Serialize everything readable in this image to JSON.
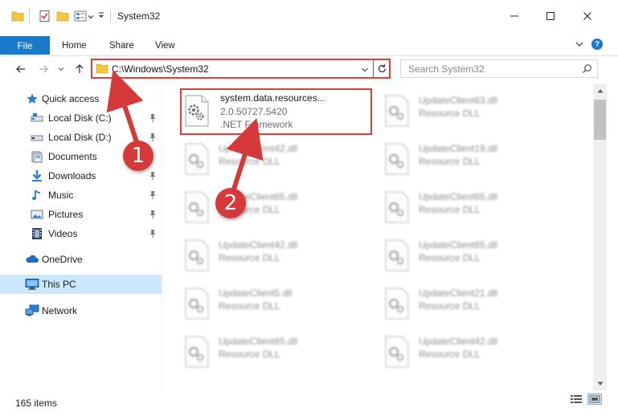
{
  "window": {
    "title": "System32",
    "min_label": "─",
    "max_label": "☐",
    "close_label": "✕"
  },
  "ribbon": {
    "tabs": [
      {
        "label": "File"
      },
      {
        "label": "Home"
      },
      {
        "label": "Share"
      },
      {
        "label": "View"
      }
    ],
    "help": "?"
  },
  "address_bar": {
    "path": "C:\\Windows\\System32"
  },
  "search": {
    "placeholder": "Search System32"
  },
  "sidebar": {
    "items": [
      {
        "label": "Quick access",
        "icon": "star-icon"
      },
      {
        "label": "Local Disk (C:)",
        "icon": "drive-icon"
      },
      {
        "label": "Local Disk (D:)",
        "icon": "drive-icon"
      },
      {
        "label": "Documents",
        "icon": "documents-icon"
      },
      {
        "label": "Downloads",
        "icon": "download-icon"
      },
      {
        "label": "Music",
        "icon": "music-icon"
      },
      {
        "label": "Pictures",
        "icon": "pictures-icon"
      },
      {
        "label": "Videos",
        "icon": "videos-icon"
      },
      {
        "label": "OneDrive",
        "icon": "cloud-icon"
      },
      {
        "label": "This PC",
        "icon": "computer-icon"
      },
      {
        "label": "Network",
        "icon": "network-icon"
      }
    ]
  },
  "files": {
    "highlighted": {
      "name": "system.data.resources...",
      "version": "2.0.50727.5420",
      "type": ".NET Framework"
    },
    "left": [
      {
        "name": "UpdateClient42.dll",
        "type": "Resource DLL"
      },
      {
        "name": "UpdateClient65.dll",
        "type": "Resource DLL"
      },
      {
        "name": "UpdateClient42.dll",
        "type": "Resource DLL"
      },
      {
        "name": "UpdateClient5.dll",
        "type": "Resource DLL"
      },
      {
        "name": "UpdateClient65.dll",
        "type": "Resource DLL"
      }
    ],
    "right": [
      {
        "name": "UpdateClient63.dll",
        "type": "Resource DLL"
      },
      {
        "name": "UpdateClient19.dll",
        "type": "Resource DLL"
      },
      {
        "name": "UpdateClient65.dll",
        "type": "Resource DLL"
      },
      {
        "name": "UpdateClient65.dll",
        "type": "Resource DLL"
      },
      {
        "name": "UpdateClient21.dll",
        "type": "Resource DLL"
      },
      {
        "name": "UpdateClient42.dll",
        "type": "Resource DLL"
      }
    ]
  },
  "status": {
    "item_count": "165 items"
  },
  "annotations": {
    "step1": "1",
    "step2": "2"
  },
  "colors": {
    "accent": "#1979ca",
    "highlight": "#e03c3c",
    "callout": "#d6393a",
    "selected": "#cce8ff"
  }
}
